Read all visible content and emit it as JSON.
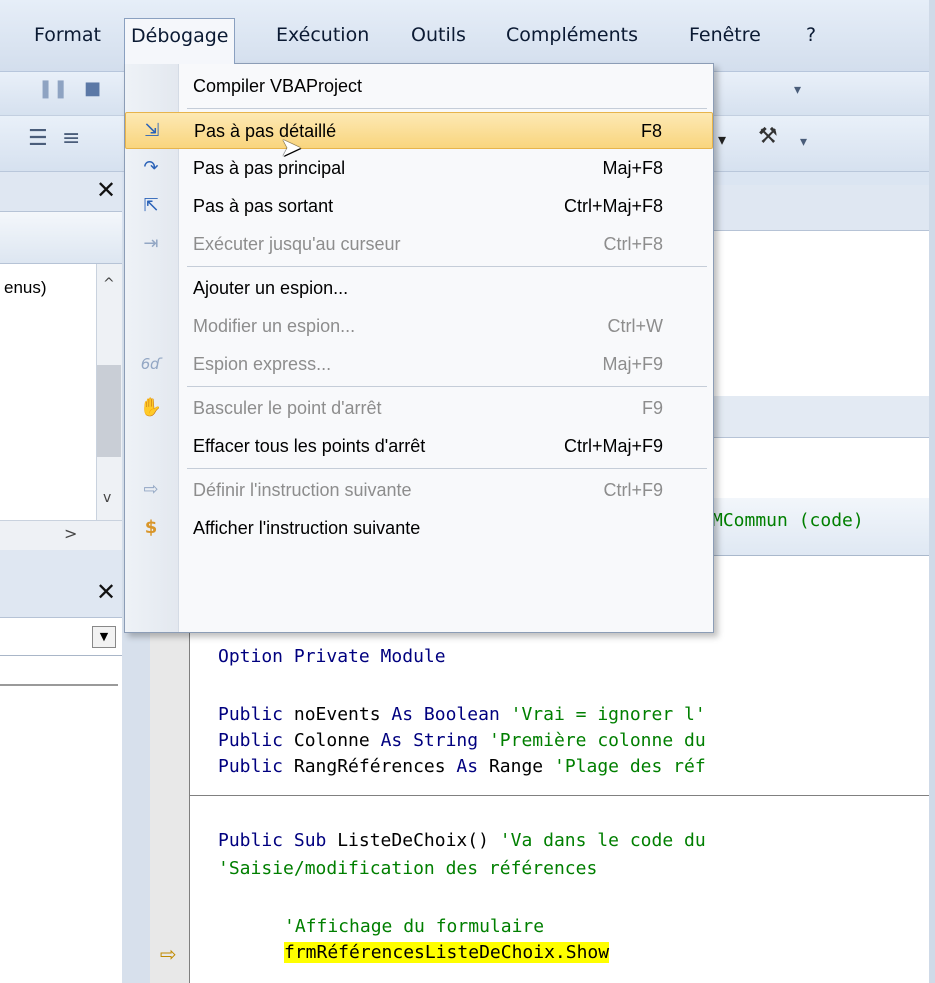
{
  "menubar": {
    "items": [
      "Format",
      "Débogage",
      "Exécution",
      "Outils",
      "Compléments",
      "Fenêtre",
      "?"
    ]
  },
  "dropdown": {
    "items": [
      {
        "label": "Compiler VBAProject",
        "shortcut": "",
        "icon": "none",
        "enabled": true
      },
      {
        "label": "Pas à pas détaillé",
        "shortcut": "F8",
        "icon": "step-into-icon",
        "enabled": true,
        "highlighted": true
      },
      {
        "label": "Pas à pas principal",
        "shortcut": "Maj+F8",
        "icon": "step-over-icon",
        "enabled": true
      },
      {
        "label": "Pas à pas sortant",
        "shortcut": "Ctrl+Maj+F8",
        "icon": "step-out-icon",
        "enabled": true
      },
      {
        "label": "Exécuter jusqu'au curseur",
        "shortcut": "Ctrl+F8",
        "icon": "run-to-cursor-icon",
        "enabled": false
      },
      {
        "label": "Ajouter un espion...",
        "shortcut": "",
        "icon": "none",
        "enabled": true
      },
      {
        "label": "Modifier un espion...",
        "shortcut": "Ctrl+W",
        "icon": "none",
        "enabled": false
      },
      {
        "label": "Espion express...",
        "shortcut": "Maj+F9",
        "icon": "quick-watch-icon",
        "enabled": false
      },
      {
        "label": "Basculer le point d'arrêt",
        "shortcut": "F9",
        "icon": "breakpoint-hand-icon",
        "enabled": false
      },
      {
        "label": "Effacer tous les points d'arrêt",
        "shortcut": "Ctrl+Maj+F9",
        "icon": "none",
        "enabled": true
      },
      {
        "label": "Définir l'instruction suivante",
        "shortcut": "Ctrl+F9",
        "icon": "set-next-arrow-icon",
        "enabled": false
      },
      {
        "label": "Afficher l'instruction suivante",
        "shortcut": "",
        "icon": "show-next-icon",
        "enabled": true
      }
    ]
  },
  "project_pane": {
    "list_item": "enus)"
  },
  "code_window": {
    "title": "MCommun (code)",
    "lines": [
      {
        "kw": "Option Private Module",
        "rest": "",
        "comment": ""
      },
      {
        "kw": "Public",
        "rest": " noEvents ",
        "kw2": "As Boolean",
        "comment": " 'Vrai = ignorer l'"
      },
      {
        "kw": "Public",
        "rest": " Colonne ",
        "kw2": "As String",
        "comment": " 'Première colonne du"
      },
      {
        "kw": "Public",
        "rest": " RangRéférences ",
        "kw2": "As",
        "rest2": " Range",
        "comment": " 'Plage des réf"
      },
      {
        "kw": "Public Sub",
        "rest": " ListeDeChoix()",
        "comment": " 'Va dans le code du"
      },
      {
        "kw": "",
        "rest": "",
        "comment": "'Saisie/modification des références"
      },
      {
        "kw": "",
        "rest": "",
        "comment": "'Affichage du formulaire"
      },
      {
        "kw": "",
        "rest": "frmRéférencesListeDeChoix.Show",
        "comment": "",
        "highlight": true
      }
    ]
  }
}
